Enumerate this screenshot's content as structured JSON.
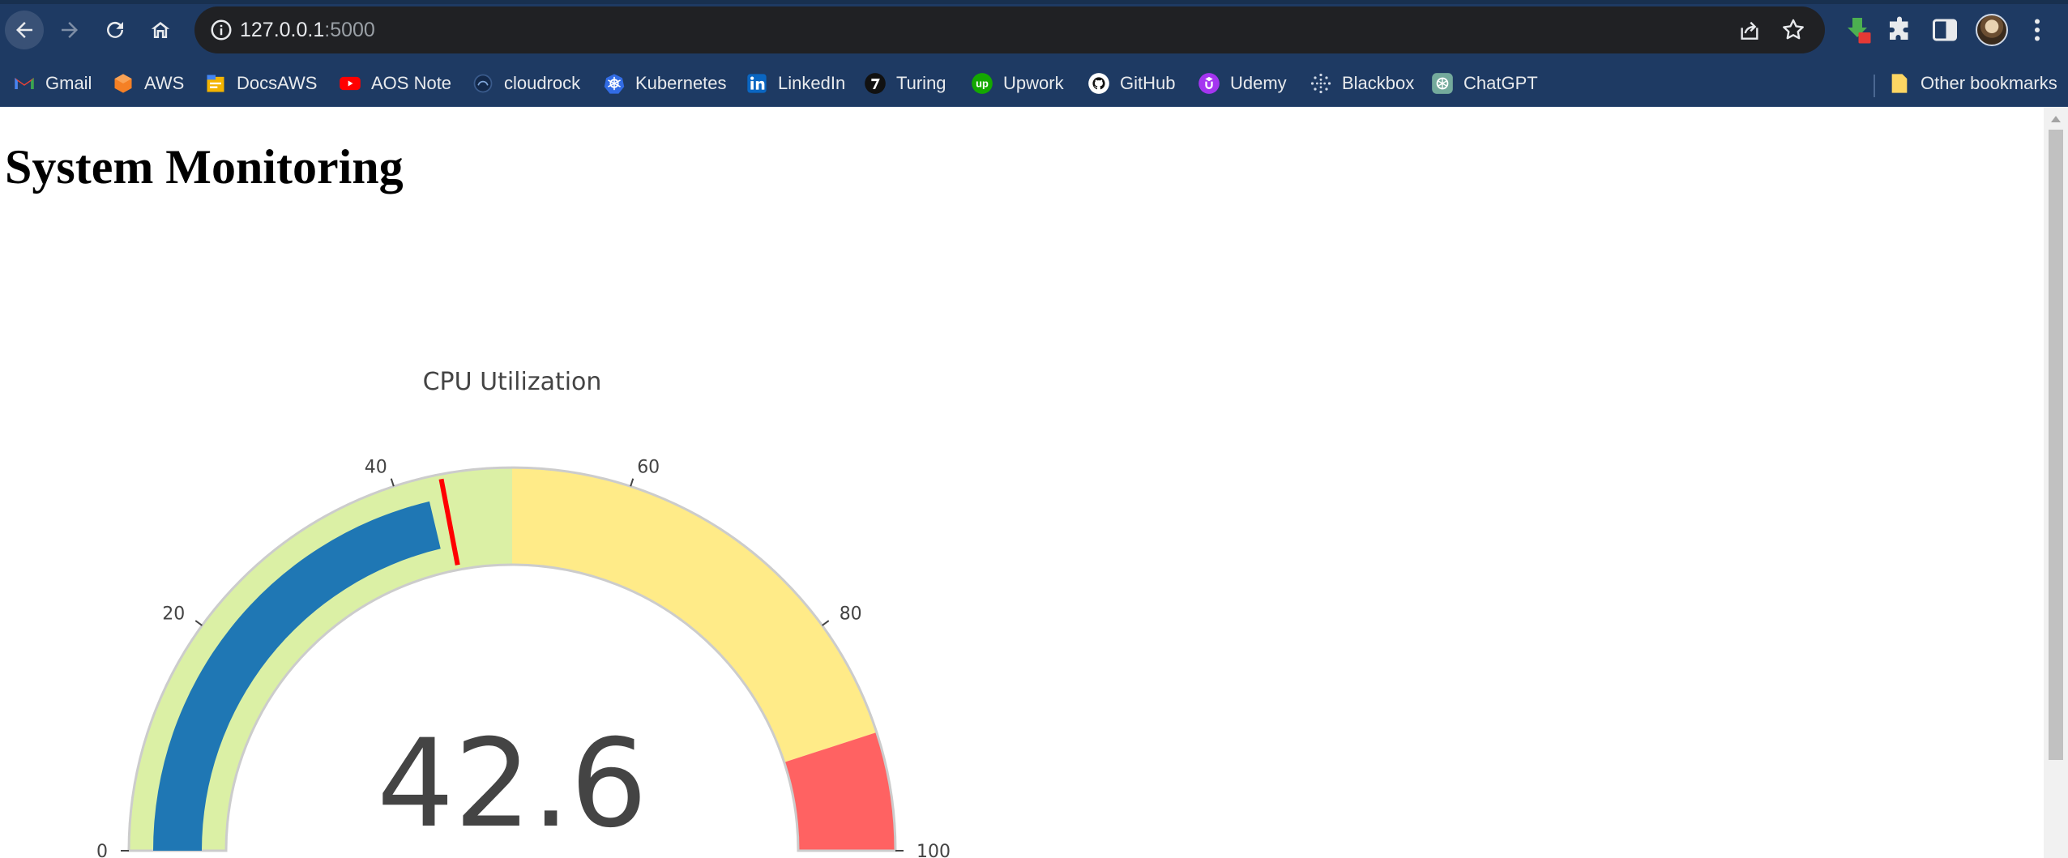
{
  "browser": {
    "url_host": "127.0.0.1",
    "url_port": ":5000"
  },
  "bookmarks": {
    "items": [
      {
        "label": "Gmail",
        "icon": "gmail-icon"
      },
      {
        "label": "AWS",
        "icon": "aws-icon"
      },
      {
        "label": "DocsAWS",
        "icon": "docsaws-icon"
      },
      {
        "label": "AOS Note",
        "icon": "youtube-icon"
      },
      {
        "label": "cloudrock",
        "icon": "cloudrock-icon"
      },
      {
        "label": "Kubernetes",
        "icon": "kubernetes-icon"
      },
      {
        "label": "LinkedIn",
        "icon": "linkedin-icon"
      },
      {
        "label": "Turing",
        "icon": "turing-icon"
      },
      {
        "label": "Upwork",
        "icon": "upwork-icon"
      },
      {
        "label": "GitHub",
        "icon": "github-icon"
      },
      {
        "label": "Udemy",
        "icon": "udemy-icon"
      },
      {
        "label": "Blackbox",
        "icon": "blackbox-icon"
      },
      {
        "label": "ChatGPT",
        "icon": "chatgpt-icon"
      }
    ],
    "other_label": "Other bookmarks"
  },
  "page": {
    "title": "System Monitoring"
  },
  "chart_data": {
    "type": "gauge",
    "title": "CPU Utilization",
    "value": 42.6,
    "value_label": "42.6",
    "range": [
      0,
      100
    ],
    "ticks": [
      0,
      20,
      40,
      60,
      80,
      100
    ],
    "tick_labels": [
      "0",
      "20",
      "40",
      "60",
      "80",
      "100"
    ],
    "steps": [
      {
        "range": [
          0,
          50
        ],
        "color": "#dbf0a5"
      },
      {
        "range": [
          50,
          90
        ],
        "color": "#ffeb88"
      },
      {
        "range": [
          90,
          100
        ],
        "color": "#ff6262"
      }
    ],
    "bar_color": "#1f77b4",
    "threshold": {
      "value": 44,
      "color": "#ff0000"
    },
    "border_color": "#cccccc"
  }
}
